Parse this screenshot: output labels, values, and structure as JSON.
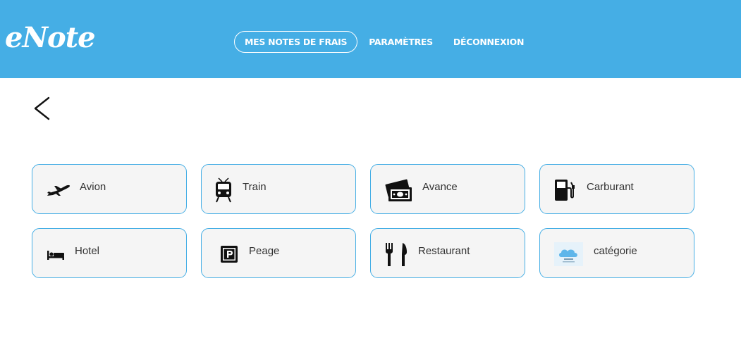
{
  "app": {
    "logo": "eNote"
  },
  "nav": {
    "items": [
      {
        "label": "MES NOTES DE FRAIS"
      },
      {
        "label": "PARAMÈTRES"
      },
      {
        "label": "DÉCONNEXION"
      }
    ]
  },
  "colors": {
    "header": "#45aee5",
    "tile_border": "#45aee5",
    "tile_bg": "#f5f5f5"
  },
  "categories": [
    {
      "label": "Avion",
      "icon": "airplane-icon"
    },
    {
      "label": "Train",
      "icon": "train-icon"
    },
    {
      "label": "Avance",
      "icon": "cash-icon"
    },
    {
      "label": "Carburant",
      "icon": "fuel-pump-icon"
    },
    {
      "label": "Hotel",
      "icon": "bed-icon"
    },
    {
      "label": "Peage",
      "icon": "parking-icon"
    },
    {
      "label": "Restaurant",
      "icon": "cutlery-icon"
    },
    {
      "label": "catégorie",
      "icon": "cloud-logo-icon"
    }
  ]
}
